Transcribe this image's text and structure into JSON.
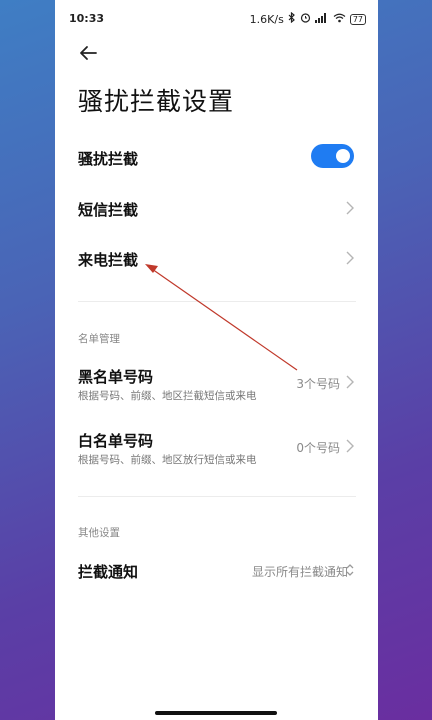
{
  "status_bar": {
    "time": "10:33",
    "speed": "1.6K/s",
    "battery": "77"
  },
  "header": {
    "title": "骚扰拦截设置"
  },
  "settings": {
    "harassment_block": {
      "label": "骚扰拦截",
      "enabled": true
    },
    "sms_block": {
      "label": "短信拦截"
    },
    "call_block": {
      "label": "来电拦截"
    }
  },
  "list_management": {
    "header": "名单管理",
    "blacklist": {
      "label": "黑名单号码",
      "sub": "根据号码、前缀、地区拦截短信或来电",
      "value": "3个号码"
    },
    "whitelist": {
      "label": "白名单号码",
      "sub": "根据号码、前缀、地区放行短信或来电",
      "value": "0个号码"
    }
  },
  "other_settings": {
    "header": "其他设置",
    "block_notification": {
      "label": "拦截通知",
      "value": "显示所有拦截通知"
    }
  },
  "colors": {
    "accent": "#1f7cf2",
    "annotation_arrow": "#c0392b"
  }
}
